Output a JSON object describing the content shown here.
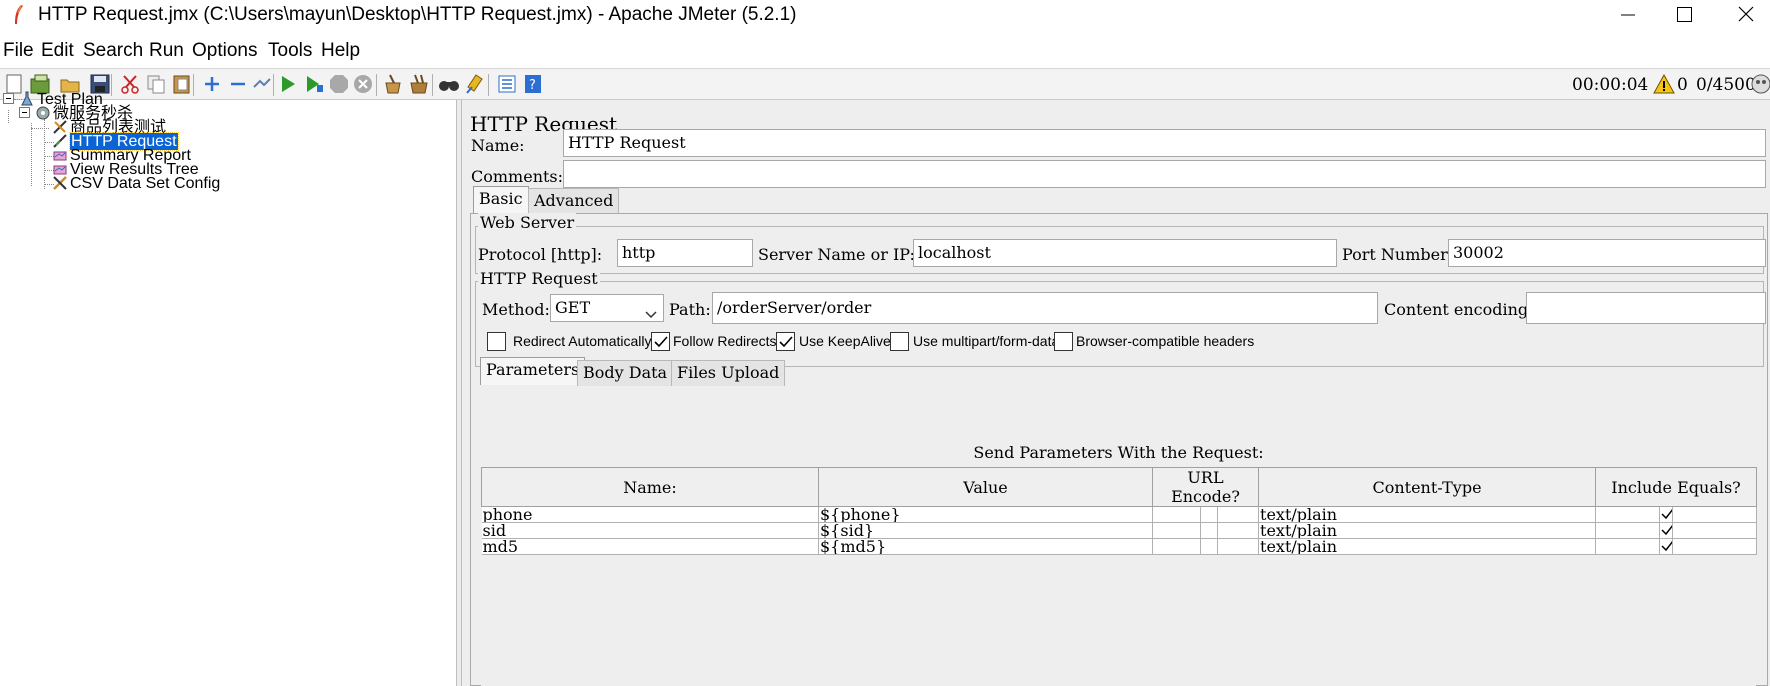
{
  "window": {
    "title": "HTTP Request.jmx (C:\\Users\\mayun\\Desktop\\HTTP Request.jmx) - Apache JMeter (5.2.1)",
    "app_icon": "jmeter-feather-icon",
    "controls": [
      "minimize-icon",
      "maximize-icon",
      "close-icon"
    ]
  },
  "menu": [
    "File",
    "Edit",
    "Search",
    "Run",
    "Options",
    "Tools",
    "Help"
  ],
  "toolbar": {
    "icons": [
      "new-icon",
      "templates-icon",
      "open-icon",
      "save-icon",
      "cut-icon",
      "copy-icon",
      "paste-icon",
      "expand-icon",
      "collapse-icon",
      "toggle-icon",
      "start-icon",
      "start-no-pause-icon",
      "stop-icon",
      "shutdown-icon",
      "clear-icon",
      "clear-all-icon",
      "search-icon",
      "reset-search-icon",
      "function-helper-icon",
      "help-icon"
    ],
    "timer": "00:00:04",
    "error_count": "0",
    "threads": "0/4500",
    "accent_green": "#2b9a2b",
    "accent_blue": "#2a6fd1"
  },
  "tree": {
    "items": [
      {
        "label": "Test Plan",
        "icon": "test-plan-icon"
      },
      {
        "label": "微服务秒杀",
        "icon": "thread-group-icon"
      },
      {
        "label": "商品列表测试",
        "icon": "sampler-icon"
      },
      {
        "label": "HTTP Request",
        "icon": "sampler-icon",
        "selected": true
      },
      {
        "label": "Summary Report",
        "icon": "listener-icon"
      },
      {
        "label": "View Results Tree",
        "icon": "listener-icon"
      },
      {
        "label": "CSV Data Set Config",
        "icon": "config-icon"
      }
    ],
    "selection_color": "#0a64d6"
  },
  "form": {
    "panel_title": "HTTP Request",
    "name_label": "Name:",
    "name_value": "HTTP Request",
    "comments_label": "Comments:",
    "comments_value": "",
    "tabs": [
      "Basic",
      "Advanced"
    ],
    "active_tab": "Basic",
    "web_server": {
      "title": "Web Server",
      "protocol_label": "Protocol [http]:",
      "protocol_value": "http",
      "server_label": "Server Name or IP:",
      "server_value": "localhost",
      "port_label": "Port Number:",
      "port_value": "30002"
    },
    "http_request": {
      "title": "HTTP Request",
      "method_label": "Method:",
      "method_value": "GET",
      "path_label": "Path:",
      "path_value": "/orderServer/order",
      "encoding_label": "Content encoding:",
      "encoding_value": ""
    },
    "checkboxes": [
      {
        "label": "Redirect Automatically",
        "checked": false
      },
      {
        "label": "Follow Redirects",
        "checked": true
      },
      {
        "label": "Use KeepAlive",
        "checked": true
      },
      {
        "label": "Use multipart/form-data",
        "checked": false
      },
      {
        "label": "Browser-compatible headers",
        "checked": false
      }
    ],
    "sub_tabs": [
      "Parameters",
      "Body Data",
      "Files Upload"
    ],
    "active_sub_tab": "Parameters",
    "params_caption": "Send Parameters With the Request:",
    "params_columns": [
      "Name:",
      "Value",
      "URL Encode?",
      "Content-Type",
      "Include Equals?"
    ],
    "params_rows": [
      {
        "name": "phone",
        "value": "${phone}",
        "url_encode": false,
        "content_type": "text/plain",
        "include_equals": true
      },
      {
        "name": "sid",
        "value": "${sid}",
        "url_encode": false,
        "content_type": "text/plain",
        "include_equals": true
      },
      {
        "name": "md5",
        "value": "${md5}",
        "url_encode": false,
        "content_type": "text/plain",
        "include_equals": true
      }
    ]
  }
}
